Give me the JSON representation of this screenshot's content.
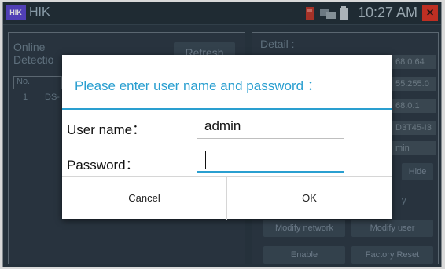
{
  "status_bar": {
    "logo_text": "HIK",
    "app_title": "HIK",
    "time": "10:27 AM"
  },
  "left_panel": {
    "title_line1": "Online",
    "title_line2": "Detectio",
    "refresh_button": "Refresh",
    "table_header_no": "No.",
    "table_row_no": "1",
    "table_row_name": "DS-"
  },
  "right_panel": {
    "detail_label": "Detail :",
    "field_ip": "68.0.64",
    "field_mask": "55.255.0",
    "field_gateway": "68.0.1",
    "field_model": "D3T45-I3",
    "field_user": "min",
    "hide_button": "Hide",
    "fragment_y": "y",
    "modify_network_button": "Modify network",
    "modify_user_button": "Modify user",
    "enable_button": "Enable",
    "factory_reset_button": "Factory Reset"
  },
  "dialog": {
    "title": "Please enter user name and password ：",
    "username_label": "User name：",
    "username_value": "admin",
    "password_label": "Password：",
    "password_value": "",
    "cancel_label": "Cancel",
    "ok_label": "OK"
  },
  "colors": {
    "accent": "#2a9fd0",
    "background": "#2c3a46",
    "close_red": "#e0382a",
    "logo_purple": "#5f4bd6"
  }
}
